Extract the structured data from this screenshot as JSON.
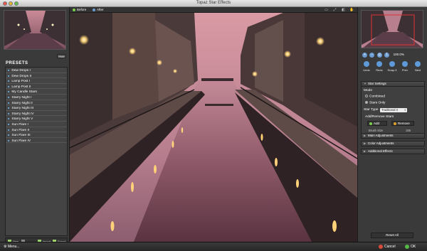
{
  "window": {
    "title": "Topaz Star Effects"
  },
  "toolbar": {
    "before_label": "Before",
    "after_label": "After",
    "icons": [
      "window-icon",
      "fullscreen-icon",
      "compare-icon",
      "hand-icon"
    ]
  },
  "presets": {
    "hide_label": "Hide",
    "title": "PRESETS",
    "items": [
      "Dew Drops I",
      "Dew Drops II",
      "Lamp Post I",
      "Lamp Post II",
      "My Candle Stars",
      "Starry Night I",
      "Starry Night II",
      "Starry Night III",
      "Starry Night IV",
      "Starry Night V",
      "Sun Flare I",
      "Sun Flare II",
      "Sun Flare III",
      "Sun Flare IV"
    ],
    "new_label": "New",
    "import_label": "Import",
    "export_label": "Export"
  },
  "navigator": {
    "zoom_level": "100.0%",
    "tools": [
      {
        "label": "Undo",
        "icon": "undo-icon"
      },
      {
        "label": "Redo",
        "icon": "redo-icon"
      },
      {
        "label": "Snap-3",
        "icon": "snapshot-icon"
      },
      {
        "label": "Prev",
        "icon": "previous-icon"
      },
      {
        "label": "Next",
        "icon": "next-icon"
      }
    ]
  },
  "settings": {
    "section_title": "Star Settings",
    "mode_label": "Mode",
    "mode_combined": "Combined",
    "mode_stars_only": "Stars Only",
    "star_type_label": "Star Type",
    "star_type_value": "Traditional II",
    "add_remove_label": "Add/Remove Stars",
    "add_label": "Add",
    "remove_label": "Remove",
    "brush_size_label": "Brush Size",
    "brush_size_value": "155",
    "main_adjustments": "Main Adjustments",
    "color_adjustments": "Color Adjustments",
    "additional_effects": "Additional Effects",
    "reset_all_label": "Reset All"
  },
  "bottom": {
    "menu_label": "Menu...",
    "cancel_label": "Cancel",
    "ok_label": "OK"
  },
  "colors": {
    "accent_green": "#7bd04b",
    "accent_blue": "#6c9cd4",
    "cancel_red": "#d84b3c",
    "ok_green": "#57b848"
  }
}
